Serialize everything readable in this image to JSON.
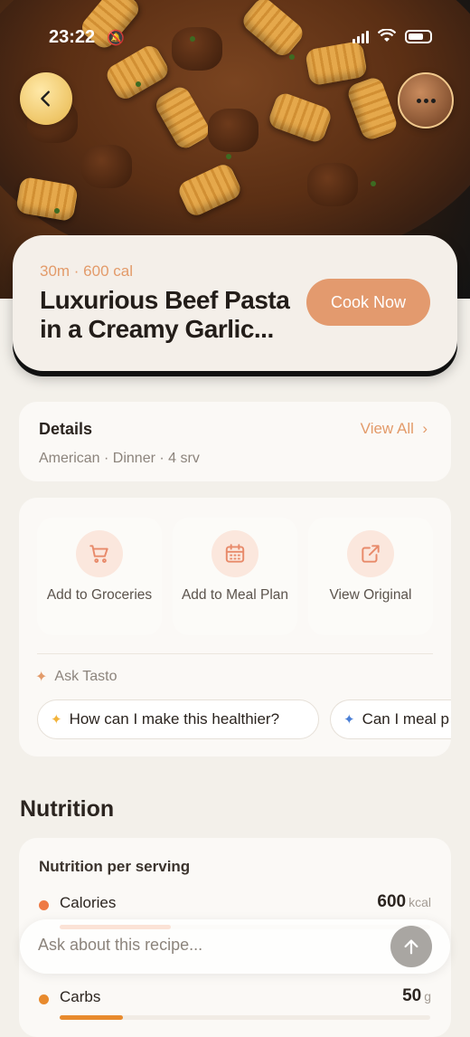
{
  "status_bar": {
    "time": "23:22"
  },
  "hero": {
    "image": "beef-rigatoni-pasta-photo"
  },
  "recipe": {
    "meta": "30m · 600 cal",
    "title_line1": "Luxurious Beef Pasta",
    "title_line2": "in a Creamy Garlic...",
    "cook_label": "Cook Now"
  },
  "details": {
    "heading": "Details",
    "view_all": "View All",
    "subtitle": "American · Dinner · 4 srv"
  },
  "actions": [
    {
      "label": "Add to Groceries",
      "icon": "cart-icon"
    },
    {
      "label": "Add to Meal Plan",
      "icon": "calendar-icon"
    },
    {
      "label": "View Original",
      "icon": "external-link-icon"
    }
  ],
  "ask_tasto": {
    "label": "Ask Tasto",
    "chips": [
      "How can I make this healthier?",
      "Can I meal p"
    ]
  },
  "nutrition": {
    "heading": "Nutrition",
    "subheading": "Nutrition per serving",
    "items": [
      {
        "name": "Calories",
        "value": "600",
        "unit": "kcal",
        "color": "#ee7a45",
        "fraction": 0.3
      },
      {
        "name": "Carbs",
        "value": "50",
        "unit": "g",
        "color": "#e88a2d",
        "fraction": 0.17
      }
    ]
  },
  "ask_input": {
    "placeholder": "Ask about this recipe..."
  },
  "colors": {
    "accent": "#e39a6e",
    "background": "#f3f0ea"
  }
}
